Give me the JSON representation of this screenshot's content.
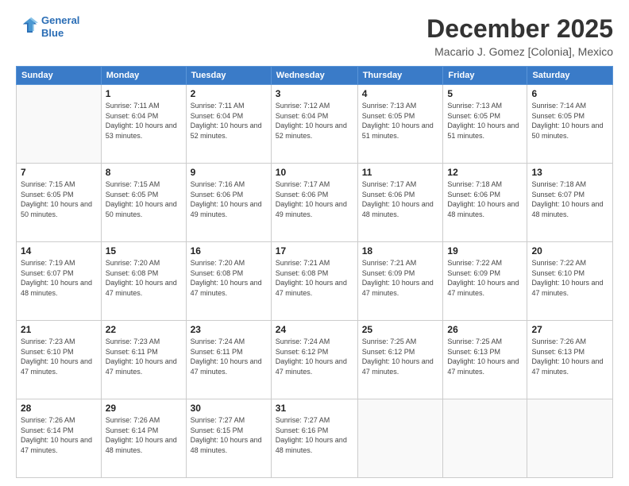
{
  "header": {
    "logo_line1": "General",
    "logo_line2": "Blue",
    "month": "December 2025",
    "location": "Macario J. Gomez [Colonia], Mexico"
  },
  "weekdays": [
    "Sunday",
    "Monday",
    "Tuesday",
    "Wednesday",
    "Thursday",
    "Friday",
    "Saturday"
  ],
  "weeks": [
    [
      {
        "day": "",
        "sunrise": "",
        "sunset": "",
        "daylight": ""
      },
      {
        "day": "1",
        "sunrise": "7:11 AM",
        "sunset": "6:04 PM",
        "daylight": "10 hours and 53 minutes."
      },
      {
        "day": "2",
        "sunrise": "7:11 AM",
        "sunset": "6:04 PM",
        "daylight": "10 hours and 52 minutes."
      },
      {
        "day": "3",
        "sunrise": "7:12 AM",
        "sunset": "6:04 PM",
        "daylight": "10 hours and 52 minutes."
      },
      {
        "day": "4",
        "sunrise": "7:13 AM",
        "sunset": "6:05 PM",
        "daylight": "10 hours and 51 minutes."
      },
      {
        "day": "5",
        "sunrise": "7:13 AM",
        "sunset": "6:05 PM",
        "daylight": "10 hours and 51 minutes."
      },
      {
        "day": "6",
        "sunrise": "7:14 AM",
        "sunset": "6:05 PM",
        "daylight": "10 hours and 50 minutes."
      }
    ],
    [
      {
        "day": "7",
        "sunrise": "7:15 AM",
        "sunset": "6:05 PM",
        "daylight": "10 hours and 50 minutes."
      },
      {
        "day": "8",
        "sunrise": "7:15 AM",
        "sunset": "6:05 PM",
        "daylight": "10 hours and 50 minutes."
      },
      {
        "day": "9",
        "sunrise": "7:16 AM",
        "sunset": "6:06 PM",
        "daylight": "10 hours and 49 minutes."
      },
      {
        "day": "10",
        "sunrise": "7:17 AM",
        "sunset": "6:06 PM",
        "daylight": "10 hours and 49 minutes."
      },
      {
        "day": "11",
        "sunrise": "7:17 AM",
        "sunset": "6:06 PM",
        "daylight": "10 hours and 48 minutes."
      },
      {
        "day": "12",
        "sunrise": "7:18 AM",
        "sunset": "6:06 PM",
        "daylight": "10 hours and 48 minutes."
      },
      {
        "day": "13",
        "sunrise": "7:18 AM",
        "sunset": "6:07 PM",
        "daylight": "10 hours and 48 minutes."
      }
    ],
    [
      {
        "day": "14",
        "sunrise": "7:19 AM",
        "sunset": "6:07 PM",
        "daylight": "10 hours and 48 minutes."
      },
      {
        "day": "15",
        "sunrise": "7:20 AM",
        "sunset": "6:08 PM",
        "daylight": "10 hours and 47 minutes."
      },
      {
        "day": "16",
        "sunrise": "7:20 AM",
        "sunset": "6:08 PM",
        "daylight": "10 hours and 47 minutes."
      },
      {
        "day": "17",
        "sunrise": "7:21 AM",
        "sunset": "6:08 PM",
        "daylight": "10 hours and 47 minutes."
      },
      {
        "day": "18",
        "sunrise": "7:21 AM",
        "sunset": "6:09 PM",
        "daylight": "10 hours and 47 minutes."
      },
      {
        "day": "19",
        "sunrise": "7:22 AM",
        "sunset": "6:09 PM",
        "daylight": "10 hours and 47 minutes."
      },
      {
        "day": "20",
        "sunrise": "7:22 AM",
        "sunset": "6:10 PM",
        "daylight": "10 hours and 47 minutes."
      }
    ],
    [
      {
        "day": "21",
        "sunrise": "7:23 AM",
        "sunset": "6:10 PM",
        "daylight": "10 hours and 47 minutes."
      },
      {
        "day": "22",
        "sunrise": "7:23 AM",
        "sunset": "6:11 PM",
        "daylight": "10 hours and 47 minutes."
      },
      {
        "day": "23",
        "sunrise": "7:24 AM",
        "sunset": "6:11 PM",
        "daylight": "10 hours and 47 minutes."
      },
      {
        "day": "24",
        "sunrise": "7:24 AM",
        "sunset": "6:12 PM",
        "daylight": "10 hours and 47 minutes."
      },
      {
        "day": "25",
        "sunrise": "7:25 AM",
        "sunset": "6:12 PM",
        "daylight": "10 hours and 47 minutes."
      },
      {
        "day": "26",
        "sunrise": "7:25 AM",
        "sunset": "6:13 PM",
        "daylight": "10 hours and 47 minutes."
      },
      {
        "day": "27",
        "sunrise": "7:26 AM",
        "sunset": "6:13 PM",
        "daylight": "10 hours and 47 minutes."
      }
    ],
    [
      {
        "day": "28",
        "sunrise": "7:26 AM",
        "sunset": "6:14 PM",
        "daylight": "10 hours and 47 minutes."
      },
      {
        "day": "29",
        "sunrise": "7:26 AM",
        "sunset": "6:14 PM",
        "daylight": "10 hours and 48 minutes."
      },
      {
        "day": "30",
        "sunrise": "7:27 AM",
        "sunset": "6:15 PM",
        "daylight": "10 hours and 48 minutes."
      },
      {
        "day": "31",
        "sunrise": "7:27 AM",
        "sunset": "6:16 PM",
        "daylight": "10 hours and 48 minutes."
      },
      {
        "day": "",
        "sunrise": "",
        "sunset": "",
        "daylight": ""
      },
      {
        "day": "",
        "sunrise": "",
        "sunset": "",
        "daylight": ""
      },
      {
        "day": "",
        "sunrise": "",
        "sunset": "",
        "daylight": ""
      }
    ]
  ]
}
